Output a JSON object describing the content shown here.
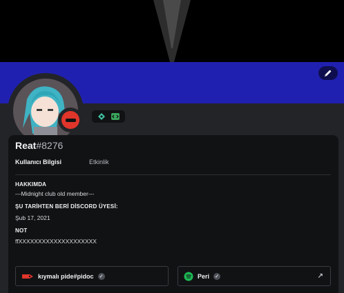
{
  "profile": {
    "username": "Reat",
    "discriminator": "#8276",
    "status": "dnd"
  },
  "tabs": [
    {
      "label": "Kullanıcı Bilgisi"
    },
    {
      "label": "Etkinlik"
    }
  ],
  "about": {
    "title": "HAKKIMDA",
    "text": "---Midnight club old member---"
  },
  "member_since": {
    "title": "ŞU TARİHTEN BERİ DİSCORD ÜYESİ:",
    "value": "Şub 17, 2021"
  },
  "note": {
    "title": "NOT",
    "value": "ffXXXXXXXXXXXXXXXXXXXX"
  },
  "connections": [
    {
      "name": "kıymalı pide#pidoc",
      "icon": "tag-icon",
      "verified": true
    },
    {
      "name": "Peri",
      "icon": "spotify-icon",
      "verified": true
    }
  ],
  "colors": {
    "banner": "#2020b0",
    "dnd": "#e0352b",
    "spotify": "#1db954"
  }
}
